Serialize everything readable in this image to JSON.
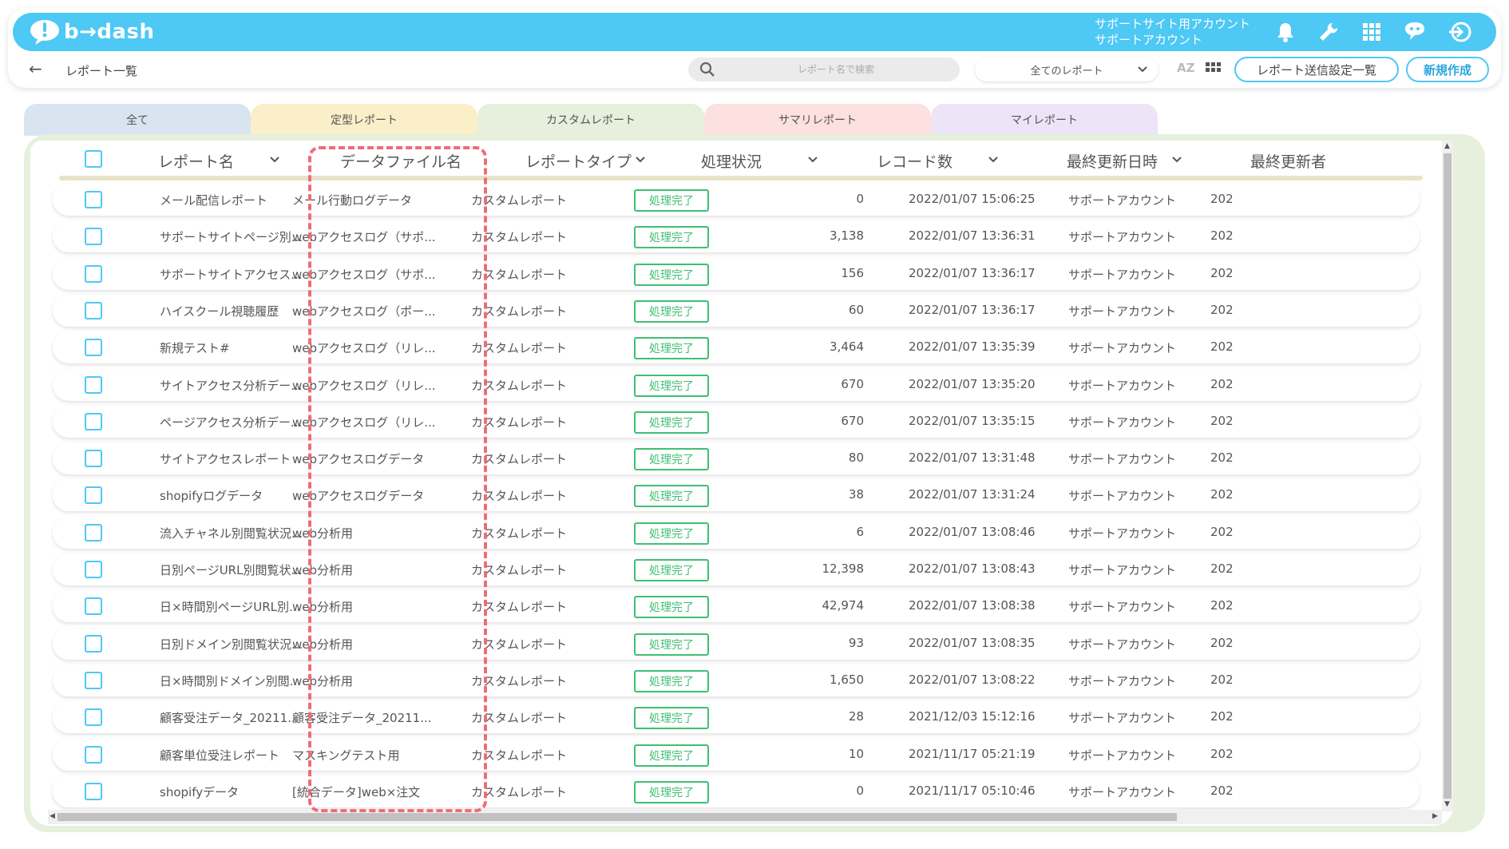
{
  "app": {
    "logo_text": "b→dash",
    "account_line1": "サポートサイト用アカウント",
    "account_line2": "サポートアカウント",
    "accent_color": "#4ec8f4"
  },
  "topbar_icons": [
    "bell-icon",
    "wrench-icon",
    "apps-grid-icon",
    "support-chat-icon",
    "logout-icon"
  ],
  "subbar": {
    "back_icon": "back-arrow-icon",
    "title": "レポート一覧",
    "search_placeholder": "レポート名で検索",
    "report_filter": "全てのレポート",
    "sort_label": "AZ",
    "send_settings_button": "レポート送信設定一覧",
    "new_button": "新規作成"
  },
  "tabs": [
    {
      "label": "全て",
      "color": "#d8e4f0"
    },
    {
      "label": "定型レポート",
      "color": "#fbefc9"
    },
    {
      "label": "カスタムレポート",
      "color": "#e6f0dc"
    },
    {
      "label": "サマリレポート",
      "color": "#fde0e0"
    },
    {
      "label": "マイレポート",
      "color": "#eee4f8"
    }
  ],
  "table": {
    "columns": [
      "レポート名",
      "データファイル名",
      "レポートタイプ",
      "処理状況",
      "レコード数",
      "最終更新日時",
      "最終更新者"
    ],
    "status_color": "#3fbf72",
    "rows": [
      {
        "name": "メール配信レポート",
        "file": "メール行動ログデータ",
        "type": "カスタムレポート",
        "status": "処理完了",
        "records": "0",
        "updated": "2022/01/07 15:06:25",
        "updater": "サポートアカウント",
        "extra": "202"
      },
      {
        "name": "サポートサイトページ別...",
        "file": "webアクセスログ（サポ...",
        "type": "カスタムレポート",
        "status": "処理完了",
        "records": "3,138",
        "updated": "2022/01/07 13:36:31",
        "updater": "サポートアカウント",
        "extra": "202"
      },
      {
        "name": "サポートサイトアクセス...",
        "file": "webアクセスログ（サポ...",
        "type": "カスタムレポート",
        "status": "処理完了",
        "records": "156",
        "updated": "2022/01/07 13:36:17",
        "updater": "サポートアカウント",
        "extra": "202"
      },
      {
        "name": "ハイスクール視聴履歴",
        "file": "webアクセスログ（ポー...",
        "type": "カスタムレポート",
        "status": "処理完了",
        "records": "60",
        "updated": "2022/01/07 13:36:17",
        "updater": "サポートアカウント",
        "extra": "202"
      },
      {
        "name": "新規テスト#",
        "file": "webアクセスログ（リレ...",
        "type": "カスタムレポート",
        "status": "処理完了",
        "records": "3,464",
        "updated": "2022/01/07 13:35:39",
        "updater": "サポートアカウント",
        "extra": "202"
      },
      {
        "name": "サイトアクセス分析デー...",
        "file": "webアクセスログ（リレ...",
        "type": "カスタムレポート",
        "status": "処理完了",
        "records": "670",
        "updated": "2022/01/07 13:35:20",
        "updater": "サポートアカウント",
        "extra": "202"
      },
      {
        "name": "ページアクセス分析デー...",
        "file": "webアクセスログ（リレ...",
        "type": "カスタムレポート",
        "status": "処理完了",
        "records": "670",
        "updated": "2022/01/07 13:35:15",
        "updater": "サポートアカウント",
        "extra": "202"
      },
      {
        "name": "サイトアクセスレポート",
        "file": "webアクセスログデータ",
        "type": "カスタムレポート",
        "status": "処理完了",
        "records": "80",
        "updated": "2022/01/07 13:31:48",
        "updater": "サポートアカウント",
        "extra": "202"
      },
      {
        "name": "shopifyログデータ",
        "file": "webアクセスログデータ",
        "type": "カスタムレポート",
        "status": "処理完了",
        "records": "38",
        "updated": "2022/01/07 13:31:24",
        "updater": "サポートアカウント",
        "extra": "202"
      },
      {
        "name": "流入チャネル別閲覧状況...",
        "file": "web分析用",
        "type": "カスタムレポート",
        "status": "処理完了",
        "records": "6",
        "updated": "2022/01/07 13:08:46",
        "updater": "サポートアカウント",
        "extra": "202"
      },
      {
        "name": "日別ページURL別閲覧状...",
        "file": "web分析用",
        "type": "カスタムレポート",
        "status": "処理完了",
        "records": "12,398",
        "updated": "2022/01/07 13:08:43",
        "updater": "サポートアカウント",
        "extra": "202"
      },
      {
        "name": "日×時間別ページURL別...",
        "file": "web分析用",
        "type": "カスタムレポート",
        "status": "処理完了",
        "records": "42,974",
        "updated": "2022/01/07 13:08:38",
        "updater": "サポートアカウント",
        "extra": "202"
      },
      {
        "name": "日別ドメイン別閲覧状況...",
        "file": "web分析用",
        "type": "カスタムレポート",
        "status": "処理完了",
        "records": "93",
        "updated": "2022/01/07 13:08:35",
        "updater": "サポートアカウント",
        "extra": "202"
      },
      {
        "name": "日×時間別ドメイン別閲...",
        "file": "web分析用",
        "type": "カスタムレポート",
        "status": "処理完了",
        "records": "1,650",
        "updated": "2022/01/07 13:08:22",
        "updater": "サポートアカウント",
        "extra": "202"
      },
      {
        "name": "顧客受注データ_20211...",
        "file": "顧客受注データ_20211...",
        "type": "カスタムレポート",
        "status": "処理完了",
        "records": "28",
        "updated": "2021/12/03 15:12:16",
        "updater": "サポートアカウント",
        "extra": "202"
      },
      {
        "name": "顧客単位受注レポート",
        "file": "マスキングテスト用",
        "type": "カスタムレポート",
        "status": "処理完了",
        "records": "10",
        "updated": "2021/11/17 05:21:19",
        "updater": "サポートアカウント",
        "extra": "202"
      },
      {
        "name": "shopifyデータ",
        "file": "[統合データ]web×注文",
        "type": "カスタムレポート",
        "status": "処理完了",
        "records": "0",
        "updated": "2021/11/17 05:10:46",
        "updater": "サポートアカウント",
        "extra": "202"
      }
    ]
  },
  "annotation": {
    "highlight_color": "#f06b78"
  }
}
